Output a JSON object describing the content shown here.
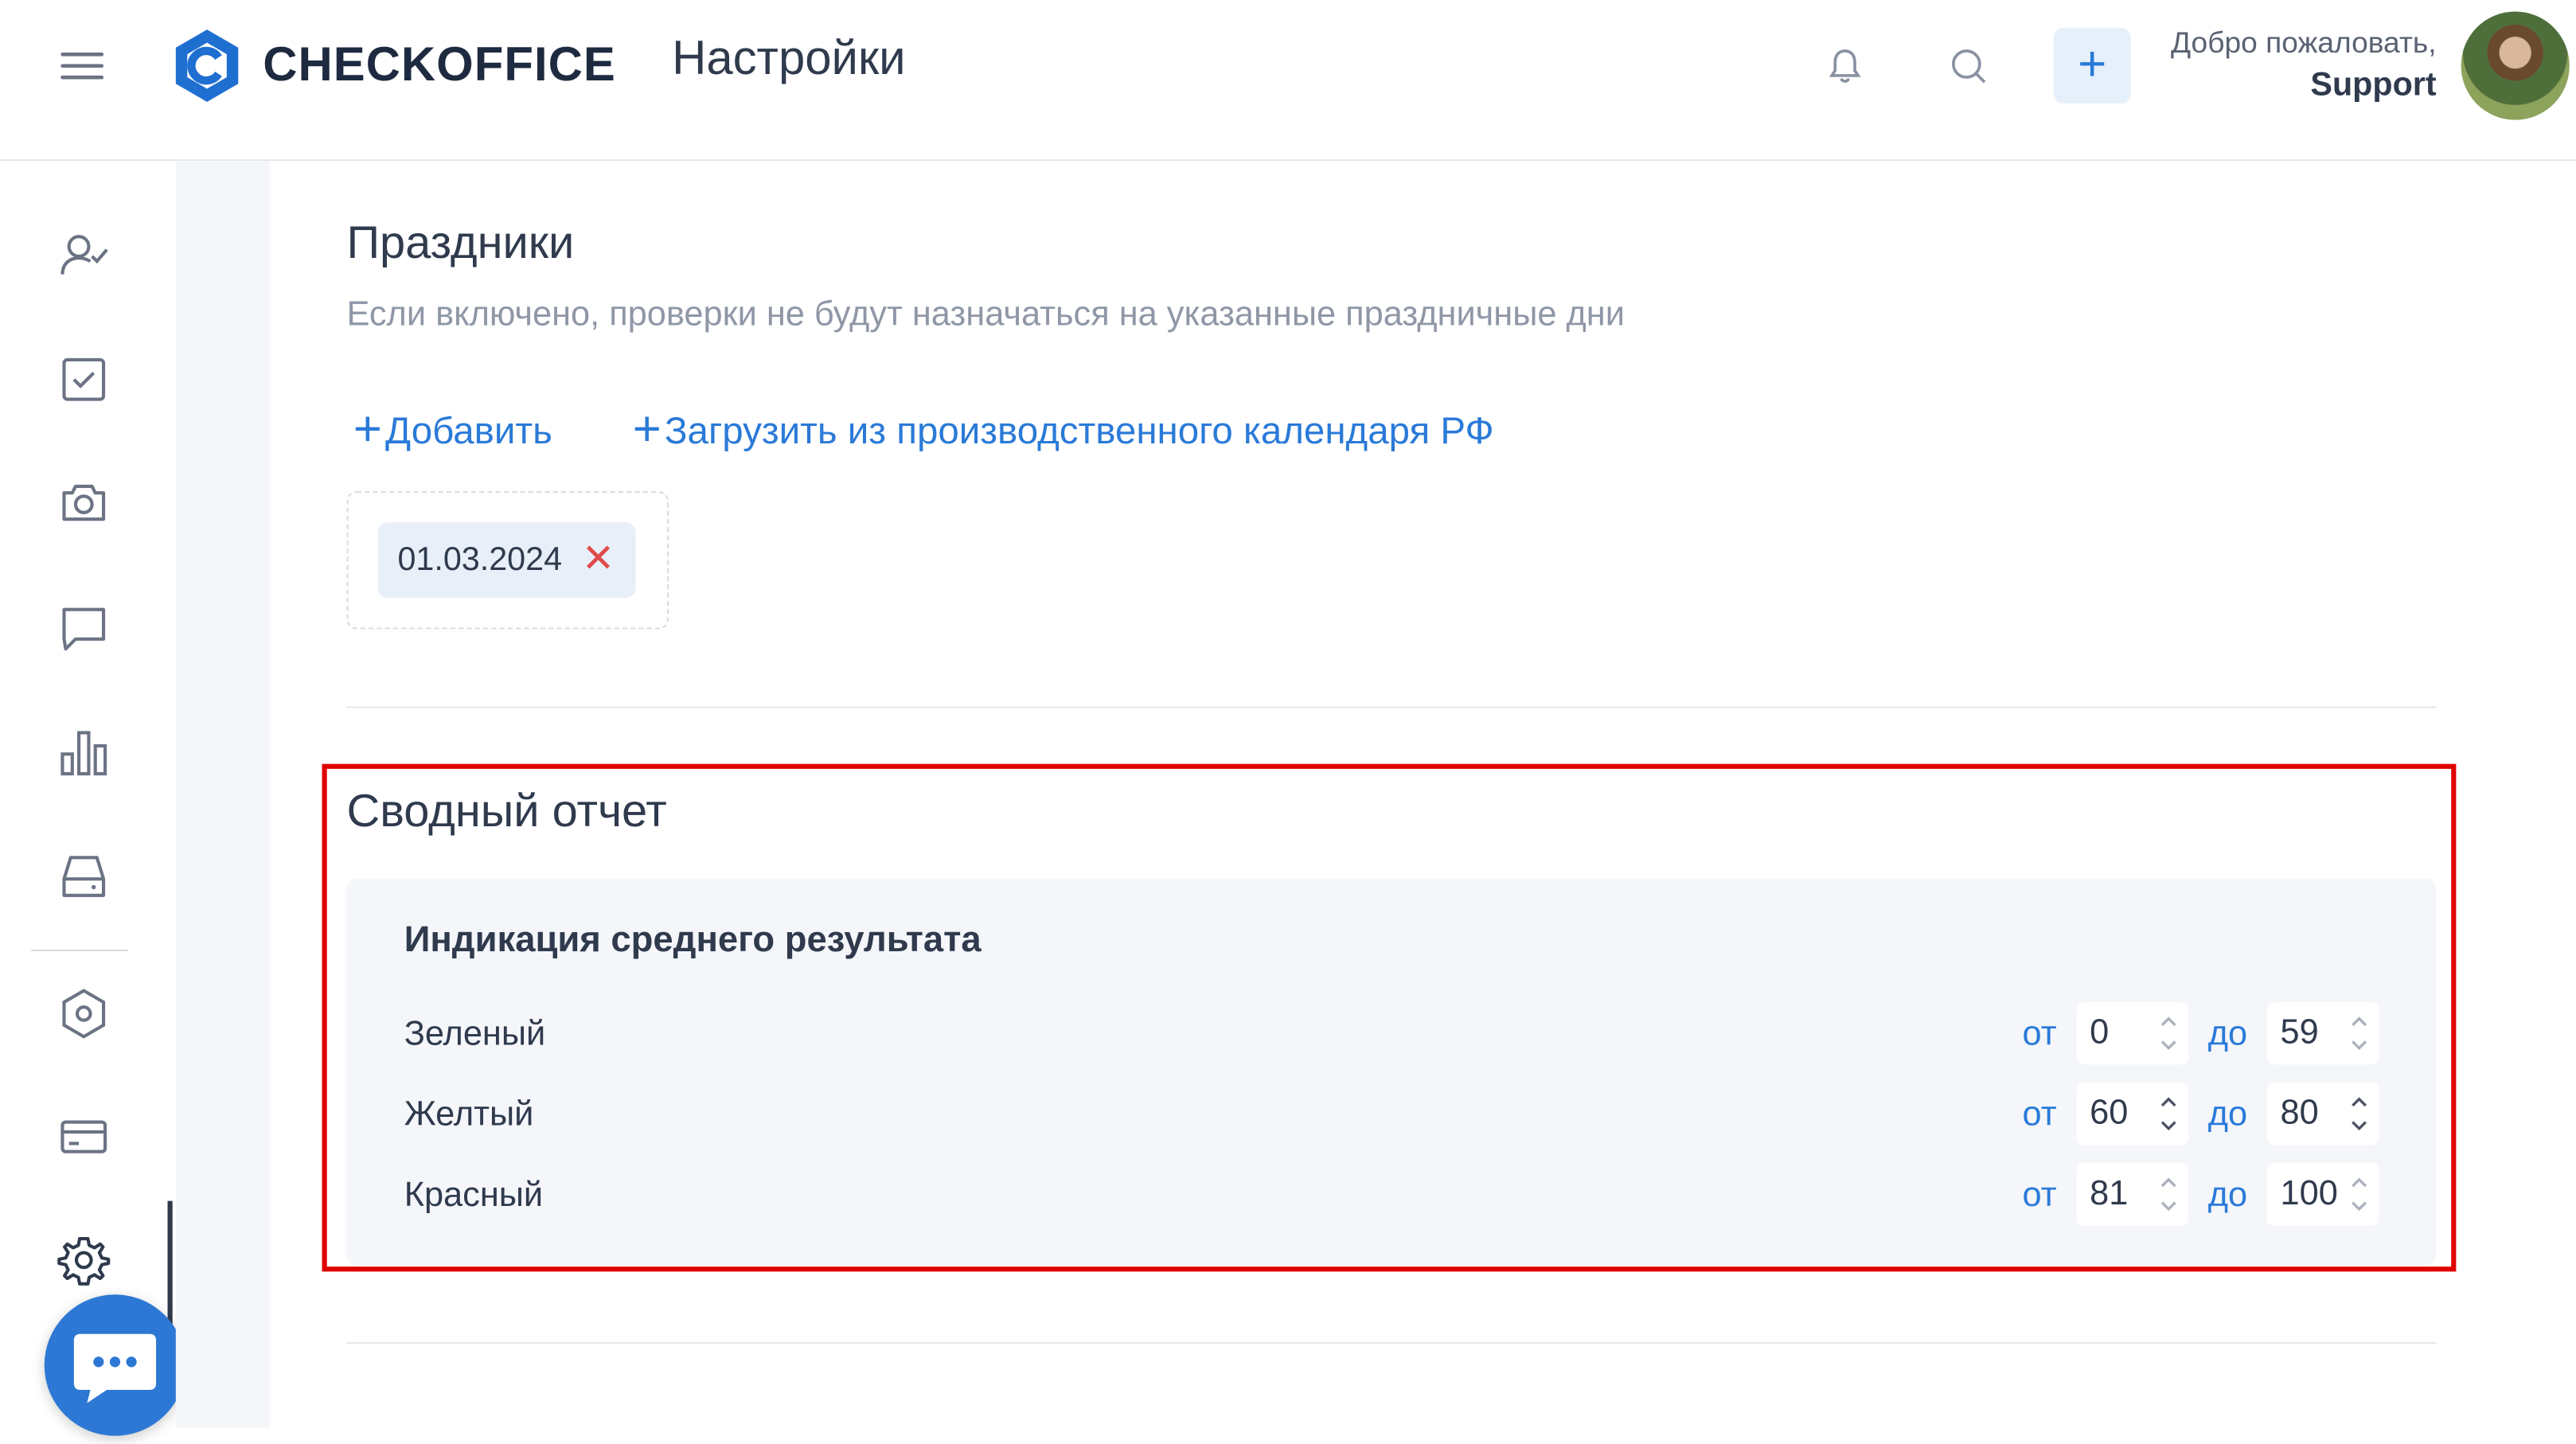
{
  "header": {
    "brand": "CHECKOFFICE",
    "page_title": "Настройки",
    "add_label": "+",
    "welcome_line": "Добро пожаловать,",
    "user_name": "Support"
  },
  "sidebar": {
    "items": [
      {
        "icon": "user-check-icon"
      },
      {
        "icon": "checkbox-icon"
      },
      {
        "icon": "camera-icon"
      },
      {
        "icon": "message-icon"
      },
      {
        "icon": "bar-chart-icon"
      },
      {
        "icon": "drive-icon"
      },
      {
        "icon": "hexagon-settings-icon"
      },
      {
        "icon": "card-icon"
      },
      {
        "icon": "gear-icon",
        "active": true
      }
    ]
  },
  "holidays": {
    "title": "Праздники",
    "subtitle": "Если включено, проверки не будут назначаться на указанные праздничные дни",
    "add_link": "Добавить",
    "load_link": "Загрузить из производственного календаря РФ",
    "dates": [
      "01.03.2024"
    ]
  },
  "summary": {
    "title": "Сводный отчет",
    "panel_title": "Индикация среднего результата",
    "from_label": "от",
    "to_label": "до",
    "rows": [
      {
        "label": "Зеленый",
        "from": "0",
        "to": "59"
      },
      {
        "label": "Желтый",
        "from": "60",
        "to": "80"
      },
      {
        "label": "Красный",
        "from": "81",
        "to": "100"
      }
    ]
  },
  "colors": {
    "accent": "#2a7ad8",
    "highlight": "#e00000",
    "chat_button": "#2d78d4"
  }
}
